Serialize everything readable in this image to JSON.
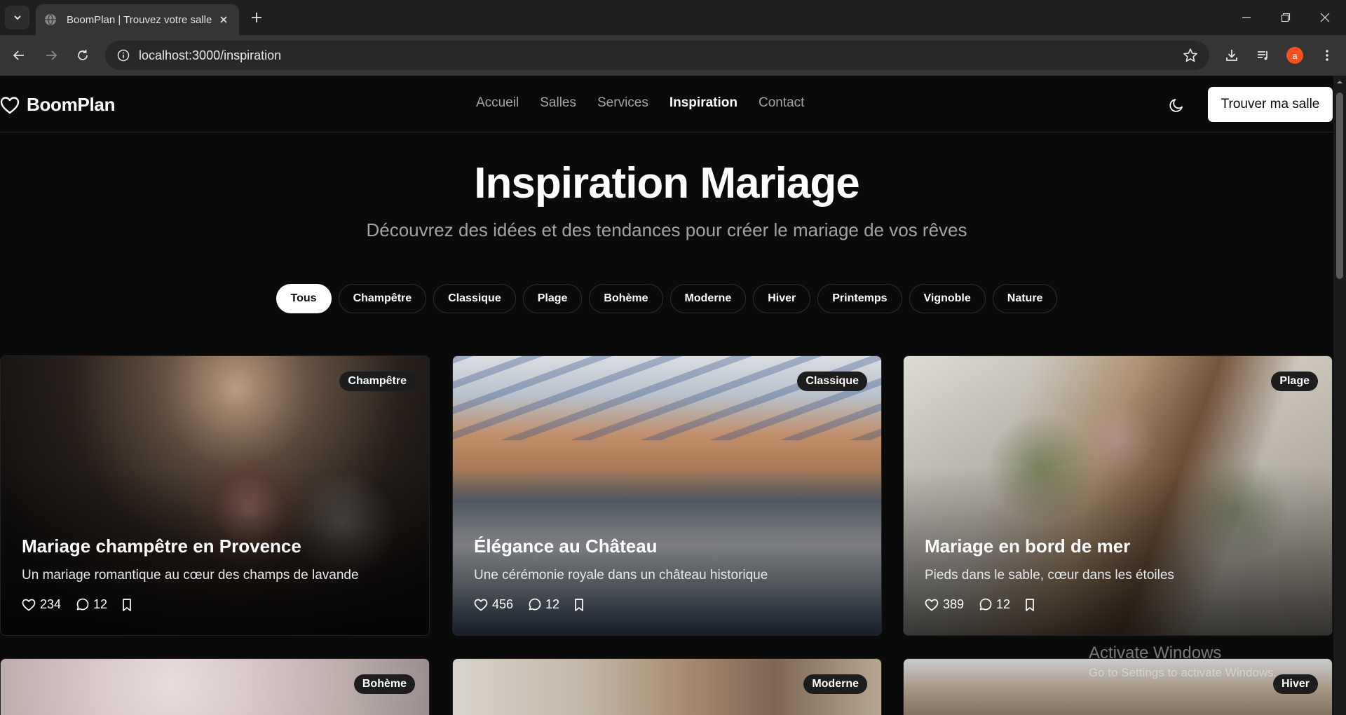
{
  "browser": {
    "tab_title": "BoomPlan | Trouvez votre salle de",
    "url": "localhost:3000/inspiration",
    "profile_initial": "a"
  },
  "site": {
    "brand": "BoomPlan",
    "nav": [
      "Accueil",
      "Salles",
      "Services",
      "Inspiration",
      "Contact"
    ],
    "active_nav": "Inspiration",
    "cta": "Trouver ma salle"
  },
  "hero": {
    "title": "Inspiration Mariage",
    "subtitle": "Découvrez des idées et des tendances pour créer le mariage de vos rêves"
  },
  "filters": [
    "Tous",
    "Champêtre",
    "Classique",
    "Plage",
    "Bohème",
    "Moderne",
    "Hiver",
    "Printemps",
    "Vignoble",
    "Nature"
  ],
  "active_filter": "Tous",
  "cards": [
    {
      "category": "Champêtre",
      "title": "Mariage champêtre en Provence",
      "description": "Un mariage romantique au cœur des champs de lavande",
      "likes": "234",
      "comments": "12"
    },
    {
      "category": "Classique",
      "title": "Élégance au Château",
      "description": "Une cérémonie royale dans un château historique",
      "likes": "456",
      "comments": "12"
    },
    {
      "category": "Plage",
      "title": "Mariage en bord de mer",
      "description": "Pieds dans le sable, cœur dans les étoiles",
      "likes": "389",
      "comments": "12"
    },
    {
      "category": "Bohème"
    },
    {
      "category": "Moderne"
    },
    {
      "category": "Hiver"
    }
  ],
  "watermark": {
    "title": "Activate Windows",
    "subtitle": "Go to Settings to activate Windows."
  }
}
